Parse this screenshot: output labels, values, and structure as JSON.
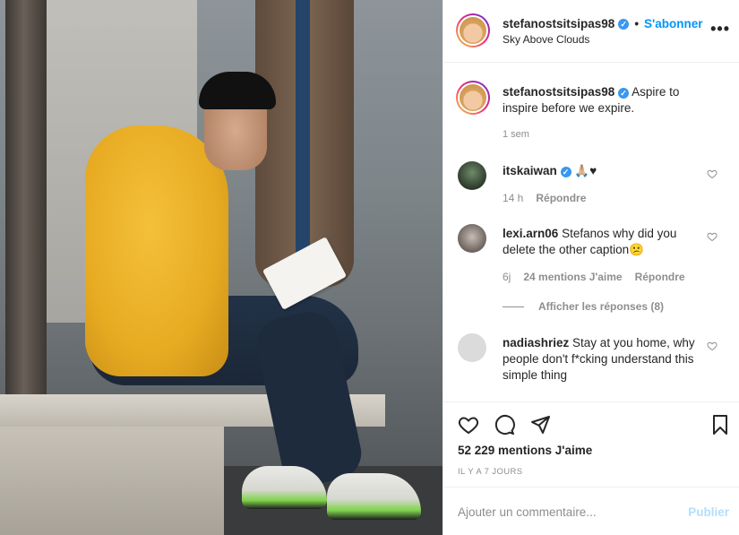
{
  "post": {
    "username": "stefanostsitsipas98",
    "follow_label": "S'abonner",
    "separator": "•",
    "location": "Sky Above Clouds",
    "more_icon": "more-horizontal-icon",
    "more_glyph": "•••"
  },
  "caption": {
    "username": "stefanostsitsipas98",
    "text": "Aspire to inspire before we expire.",
    "time": "1 sem"
  },
  "comments": [
    {
      "username": "itskaiwan",
      "verified": true,
      "text": "🙏🏼♥",
      "time": "14 h",
      "likes": "",
      "reply": "Répondre"
    },
    {
      "username": "lexi.arn06",
      "verified": false,
      "text": "Stefanos why did you delete the other caption😕",
      "time": "6j",
      "likes": "24 mentions J'aime",
      "reply": "Répondre"
    },
    {
      "username": "nadiashriez",
      "verified": false,
      "text": "Stay at you home, why people don't f*cking understand this simple thing",
      "time": "",
      "likes": "",
      "reply": ""
    }
  ],
  "view_replies": "Afficher les réponses (8)",
  "actions": {
    "likes": "52 229 mentions J'aime",
    "date": "IL Y A 7 JOURS"
  },
  "composer": {
    "placeholder": "Ajouter un commentaire...",
    "post_label": "Publier"
  },
  "colors": {
    "accent": "#0095f6",
    "verified": "#3897f0",
    "muted": "#8e8e8e"
  }
}
